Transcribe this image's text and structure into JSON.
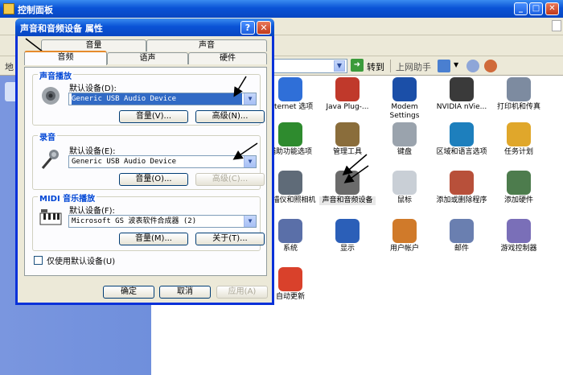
{
  "control_panel": {
    "title": "控制面板",
    "go_label": "转到",
    "up_label": "上网助手",
    "address_label": "地",
    "items": [
      {
        "label": "Internet 选项",
        "color": "#2f6fd8",
        "selected": false
      },
      {
        "label": "Java Plug-...",
        "color": "#c0392b",
        "selected": false
      },
      {
        "label": "Modem Settings",
        "color": "#1b4fa8",
        "selected": false
      },
      {
        "label": "NVIDIA nVie...",
        "color": "#3a3a3a",
        "selected": false
      },
      {
        "label": "打印机和传真",
        "color": "#7d8ba0",
        "selected": false
      },
      {
        "label": "辅助功能选项",
        "color": "#2e8b2e",
        "selected": false
      },
      {
        "label": "管理工具",
        "color": "#8a6d3b",
        "selected": false
      },
      {
        "label": "键盘",
        "color": "#9aa3ad",
        "selected": false
      },
      {
        "label": "区域和语言选项",
        "color": "#1d7fbd",
        "selected": false
      },
      {
        "label": "任务计划",
        "color": "#e0a72b",
        "selected": false
      },
      {
        "label": "扫描仪和照相机",
        "color": "#5f6b78",
        "selected": false
      },
      {
        "label": "声音和音频设备",
        "color": "#6b6b6b",
        "selected": true
      },
      {
        "label": "鼠标",
        "color": "#c9cfd6",
        "selected": false
      },
      {
        "label": "添加或删除程序",
        "color": "#b8503a",
        "selected": false
      },
      {
        "label": "添加硬件",
        "color": "#4d7c4d",
        "selected": false
      },
      {
        "label": "系统",
        "color": "#5a6fa8",
        "selected": false
      },
      {
        "label": "显示",
        "color": "#2b5fb8",
        "selected": false
      },
      {
        "label": "用户帐户",
        "color": "#d07a2a",
        "selected": false
      },
      {
        "label": "邮件",
        "color": "#6a7fb0",
        "selected": false
      },
      {
        "label": "游戏控制器",
        "color": "#7a6fb8",
        "selected": false
      },
      {
        "label": "自动更新",
        "color": "#d9412b",
        "selected": false
      }
    ]
  },
  "dialog": {
    "title": "声音和音频设备 属性",
    "help_symbol": "?",
    "close_symbol": "✕",
    "tabs": {
      "volume": "音量",
      "sound": "声音",
      "audio": "音频",
      "voice": "语声",
      "hardware": "硬件"
    },
    "playback": {
      "label": "声音播放",
      "default_device_label": "默认设备(D):",
      "device": "Generic USB Audio Device",
      "volume_btn": "音量(V)...",
      "advanced_btn": "高级(N)..."
    },
    "recording": {
      "label": "录音",
      "default_device_label": "默认设备(E):",
      "device": "Generic USB Audio Device",
      "volume_btn": "音量(O)...",
      "advanced_btn": "高级(C)..."
    },
    "midi": {
      "label": "MIDI 音乐播放",
      "default_device_label": "默认设备(F):",
      "device": "Microsoft GS 波表软件合成器 (2)",
      "volume_btn": "音量(M)...",
      "about_btn": "关于(T)..."
    },
    "default_only_label": "仅使用默认设备(U)",
    "ok": "确定",
    "cancel": "取消",
    "apply": "应用(A)"
  }
}
